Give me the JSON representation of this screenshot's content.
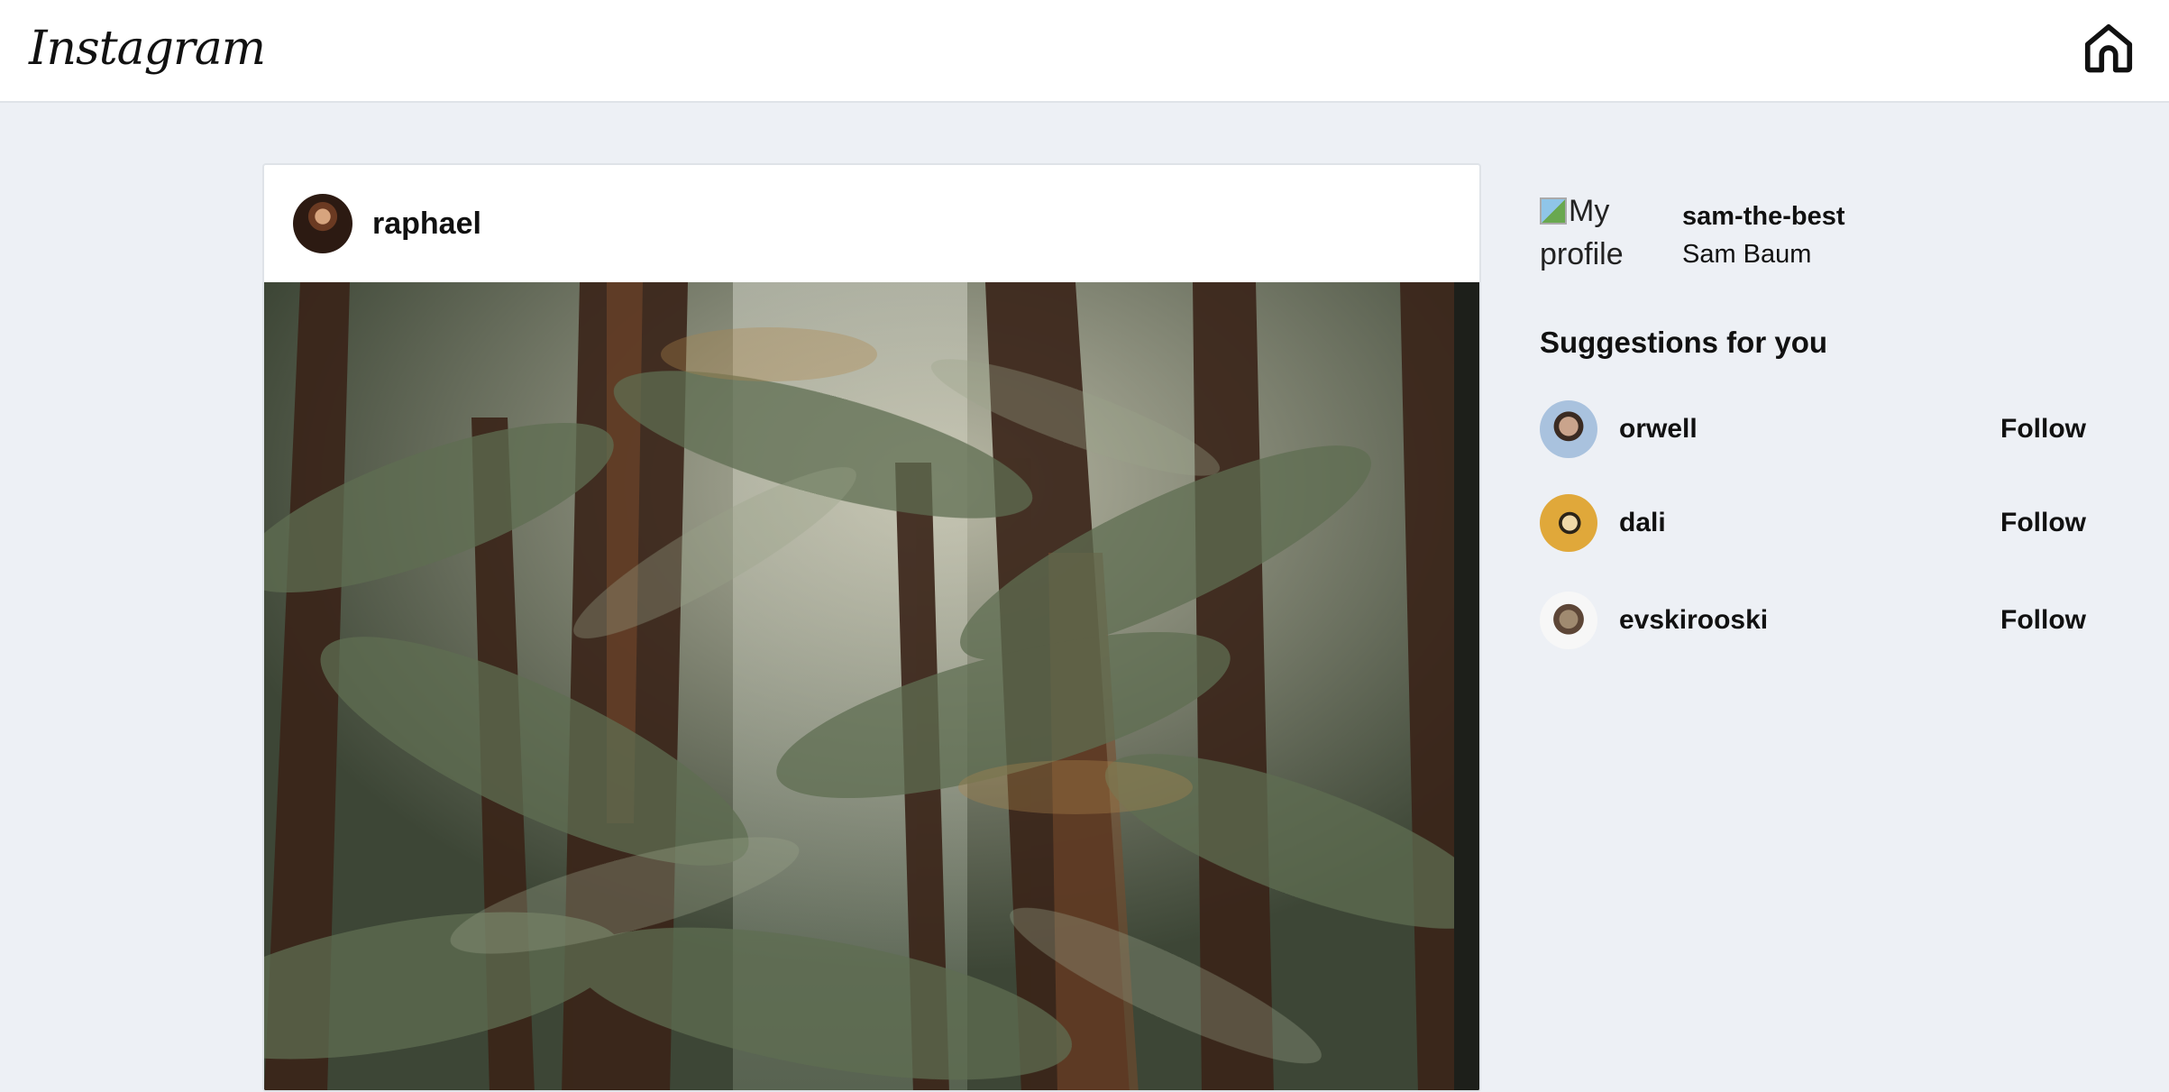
{
  "header": {
    "logo_text": "Instagram",
    "home_icon": "home-icon"
  },
  "post": {
    "username": "raphael",
    "avatar_icon": "avatar-raphael",
    "image_description_icon": "forest-photo"
  },
  "sidebar": {
    "profile": {
      "image_alt": "My profile",
      "username": "sam-the-best",
      "name": "Sam Baum"
    },
    "suggestions_title": "Suggestions for you",
    "suggestions": [
      {
        "username": "orwell",
        "follow_label": "Follow"
      },
      {
        "username": "dali",
        "follow_label": "Follow"
      },
      {
        "username": "evskirooski",
        "follow_label": "Follow"
      }
    ]
  },
  "colors": {
    "background": "#edf0f5",
    "card": "#ffffff",
    "text": "#111111"
  }
}
